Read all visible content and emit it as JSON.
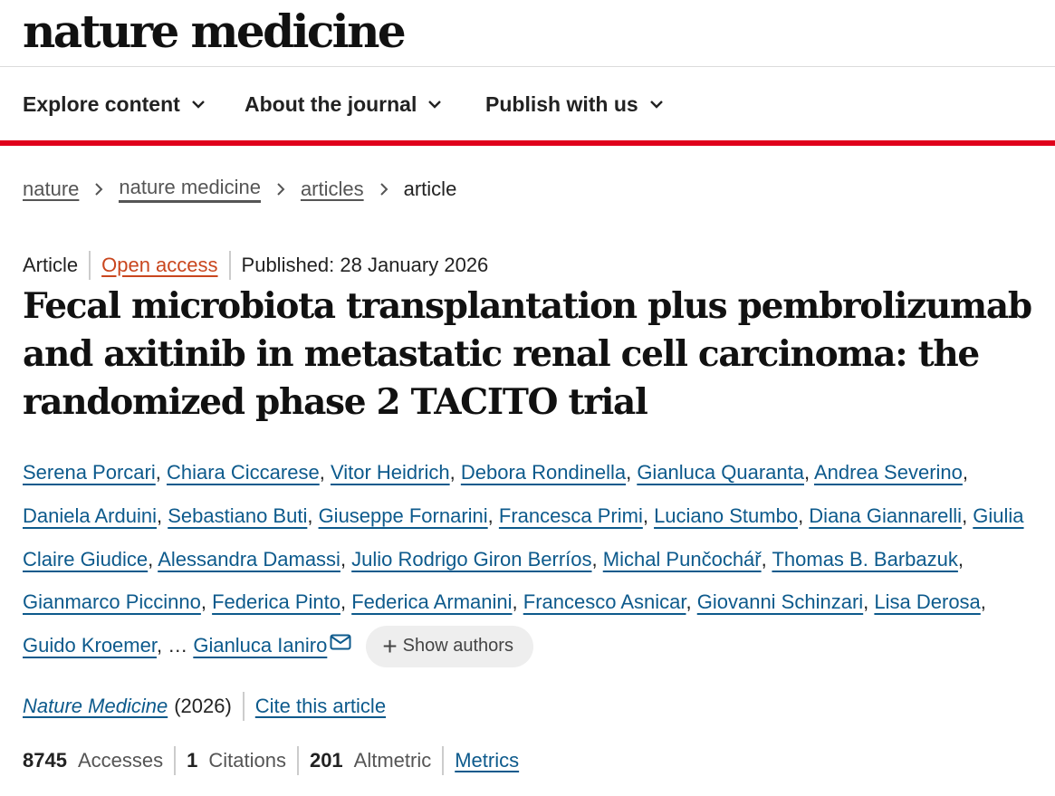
{
  "header": {
    "logo": "nature medicine",
    "nav": [
      {
        "label": "Explore content",
        "icon": "chevron-down-icon"
      },
      {
        "label": "About the journal",
        "icon": "chevron-down-icon"
      },
      {
        "label": "Publish with us",
        "icon": "chevron-down-icon"
      }
    ],
    "accent_color": "#e0001b"
  },
  "breadcrumb": {
    "items": [
      "nature",
      "nature medicine",
      "articles"
    ],
    "current": "article"
  },
  "article": {
    "type": "Article",
    "access": "Open access",
    "published": "Published: 28 January 2026",
    "title": "Fecal microbiota transplantation plus pembrolizumab and axitinib in metastatic renal cell carcinoma: the randomized phase 2 TACITO trial"
  },
  "authors": {
    "list": [
      "Serena Porcari",
      "Chiara Ciccarese",
      "Vitor Heidrich",
      "Debora Rondinella",
      "Gianluca Quaranta",
      "Andrea Severino",
      "Daniela Arduini",
      "Sebastiano Buti",
      "Giuseppe Fornarini",
      "Francesca Primi",
      "Luciano Stumbo",
      "Diana Giannarelli",
      "Giulia Claire Giudice",
      "Alessandra Damassi",
      "Julio Rodrigo Giron Berríos",
      "Michal Punčochář",
      "Thomas B. Barbazuk",
      "Gianmarco Piccinno",
      "Federica Pinto",
      "Federica Armanini",
      "Francesco Asnicar",
      "Giovanni Schinzari",
      "Lisa Derosa",
      "Guido Kroemer"
    ],
    "ellipsis": "…",
    "last_author": "Gianluca Ianiro",
    "show_authors": "Show authors"
  },
  "citation": {
    "journal": "Nature Medicine",
    "year": "(2026)",
    "cite": "Cite this article"
  },
  "metrics": {
    "accesses_value": "8745",
    "accesses_label": "Accesses",
    "citations_value": "1",
    "citations_label": "Citations",
    "altmetric_value": "201",
    "altmetric_label": "Altmetric",
    "metrics_link": "Metrics"
  }
}
